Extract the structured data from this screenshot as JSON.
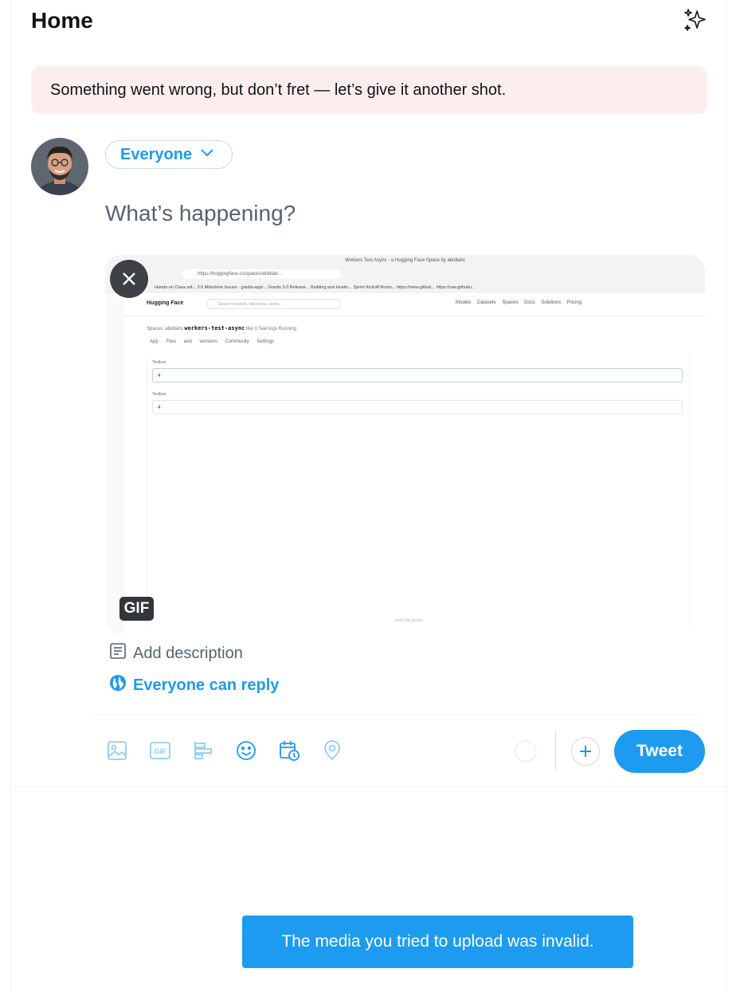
{
  "header": {
    "title": "Home",
    "icon": "sparkle-icon"
  },
  "error_banner": {
    "text": "Something went wrong, but don’t fret — let’s give it another shot."
  },
  "composer": {
    "audience_label": "Everyone",
    "placeholder": "What’s happening?",
    "media": {
      "badge": "GIF",
      "screenshot": {
        "window_title": "Workers Test Async - a Hugging Face Space by abidlabs",
        "url": "https://huggingface.co/spaces/abidlab...",
        "bookmarks": "Hands-on Class wit...   3.0 Milestone   Issues · gradio-app/...   Gradio 3.0 Release...   Building and Hostin...   Sprint Kickoff Runni...   https://view.gitbub...   https://raw.githubu...",
        "logo": "Hugging Face",
        "search_placeholder": "Search models, datasets, users...",
        "nav_links": "Models  Datasets  Spaces  Docs  Solutions  Pricing",
        "space_prefix": "Spaces:",
        "space_owner": "abidlabs",
        "space_name": "workers-test-async",
        "space_meta": "like 0   See logs   Running",
        "tabs": "App   Files and versions   Community   Settings",
        "textbox1_label": "Textbox",
        "textbox1_value": "4",
        "textbox2_label": "Textbox",
        "textbox2_value": "4",
        "footer": "built with gradio"
      }
    },
    "add_description": "Add description",
    "reply_setting": "Everyone can reply",
    "toolbar": {
      "icons": [
        "media-icon",
        "gif-icon",
        "poll-icon",
        "emoji-icon",
        "schedule-icon",
        "location-icon"
      ],
      "tweet_label": "Tweet"
    }
  },
  "toast": {
    "text": "The media you tried to upload was invalid."
  },
  "colors": {
    "accent": "#1d9bf0",
    "error_bg": "#fdeeee",
    "text": "#0f1419",
    "muted": "#536471"
  }
}
